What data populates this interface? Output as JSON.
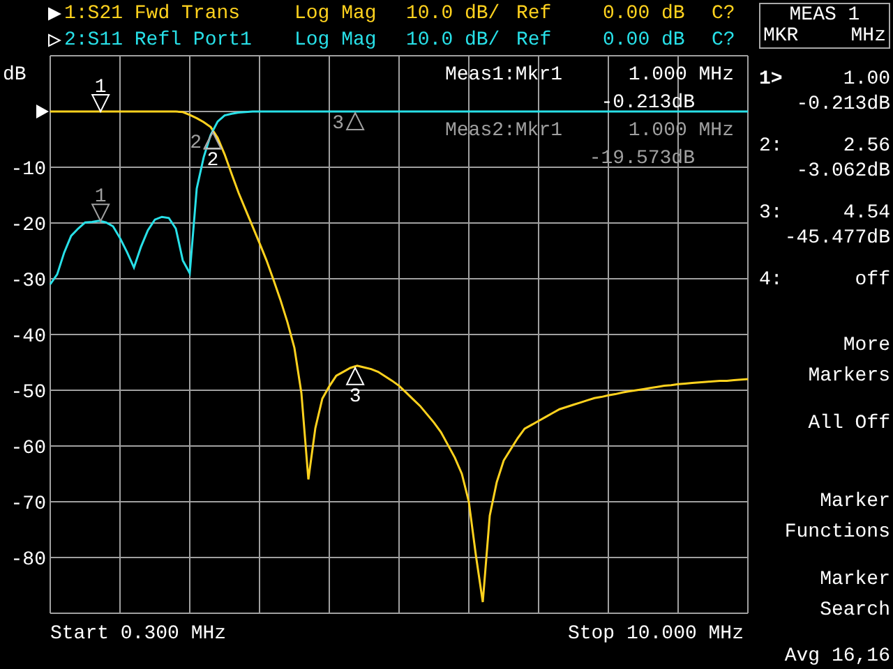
{
  "traces": [
    {
      "format": "Log Mag",
      "scale": "10.0 dB/",
      "ref_label": "Ref",
      "ref_value": "0.00 dB",
      "cal_status": "C?",
      "active": true,
      "marker_labels": [
        "1",
        "2",
        "3"
      ]
    },
    {
      "format": "Log Mag",
      "scale": "10.0 dB/",
      "ref_label": "Ref",
      "ref_value": "0.00 dB",
      "cal_status": "C?",
      "active": false,
      "marker_labels": [
        "1",
        "2",
        "3"
      ]
    }
  ],
  "readouts": [
    {
      "name": "Meas1:Mkr1",
      "frequency": "1.000 MHz",
      "value": "-0.213dB",
      "active": true
    },
    {
      "name": "Meas2:Mkr1",
      "frequency": "1.000 MHz",
      "value": "-19.573dB",
      "active": false
    }
  ],
  "chart_data": {
    "type": "line",
    "ylabel": "dB",
    "ylim": [
      -90,
      10
    ],
    "grid": true,
    "yticks": [
      {
        "value": -10,
        "label": "-10"
      },
      {
        "value": -20,
        "label": "-20"
      },
      {
        "value": -30,
        "label": "-30"
      },
      {
        "value": -40,
        "label": "-40"
      },
      {
        "value": -50,
        "label": "-50"
      },
      {
        "value": -60,
        "label": "-60"
      },
      {
        "value": -70,
        "label": "-70"
      },
      {
        "value": -80,
        "label": "-80"
      }
    ],
    "categories": [
      null,
      null,
      null,
      null,
      null,
      null,
      null,
      null,
      null,
      null,
      null,
      null,
      null,
      null,
      null,
      null,
      null,
      null,
      null,
      null,
      null,
      null,
      null,
      null,
      null,
      null,
      null,
      null,
      null,
      null,
      null,
      null,
      null,
      null,
      null,
      null,
      null,
      null,
      null,
      null,
      null,
      null,
      null,
      null,
      null,
      null,
      null,
      null,
      null,
      null,
      null,
      null,
      null,
      null,
      null,
      null,
      null,
      null,
      null,
      null,
      null,
      null,
      null,
      null,
      null,
      null,
      null,
      null,
      null,
      null,
      null,
      null,
      null,
      null,
      null,
      null,
      null,
      null,
      null,
      null,
      null,
      null,
      null,
      null,
      null,
      null,
      null,
      null,
      null,
      null,
      null,
      null,
      null,
      null,
      null,
      null,
      null,
      null,
      null,
      null,
      null
    ],
    "series": [
      {
        "name": "1:S21 Fwd Trans",
        "color": "#ffd21e",
        "values": [
          0,
          0,
          0,
          0,
          0,
          0,
          0,
          0,
          0,
          0,
          0,
          0,
          0,
          0,
          0,
          0,
          0,
          0,
          0,
          -0.1,
          -0.6,
          -1.2,
          -1.9,
          -2.8,
          -4.7,
          -7.7,
          -11.2,
          -14.6,
          -17.6,
          -20.6,
          -23.6,
          -26.7,
          -30.2,
          -33.8,
          -37.8,
          -42.4,
          -50.5,
          -66,
          -56.8,
          -51.5,
          -49.3,
          -47.4,
          -46.7,
          -46,
          -45.6,
          -45.9,
          -46.2,
          -46.7,
          -47.5,
          -48.3,
          -49.2,
          -50.4,
          -51.6,
          -52.8,
          -54.3,
          -55.8,
          -57.5,
          -59.8,
          -62.1,
          -65,
          -70,
          -79.5,
          -88,
          -72.5,
          -66.5,
          -62.6,
          -60.6,
          -58.6,
          -56.9,
          -56.2,
          -55.5,
          -54.8,
          -54.1,
          -53.4,
          -53,
          -52.6,
          -52.2,
          -51.8,
          -51.4,
          -51.2,
          -50.9,
          -50.7,
          -50.4,
          -50.2,
          -50,
          -49.8,
          -49.6,
          -49.4,
          -49.2,
          -49.1,
          -48.9,
          -48.8,
          -48.7,
          -48.6,
          -48.5,
          -48.4,
          -48.3,
          -48.3,
          -48.2,
          -48.1,
          -48
        ]
      },
      {
        "name": "2:S11 Refl Port1",
        "color": "#28e0e8",
        "values": [
          -31,
          -29.2,
          -25.3,
          -22.3,
          -21,
          -19.9,
          -19.8,
          -19.6,
          -19.9,
          -20.6,
          -22.7,
          -25.2,
          -28,
          -24.3,
          -21.3,
          -19.4,
          -18.9,
          -19.1,
          -21,
          -26.7,
          -29,
          -13.8,
          -8.2,
          -4.2,
          -1.8,
          -0.7,
          -0.4,
          -0.2,
          -0.1,
          0,
          0,
          0,
          0,
          0,
          0,
          0,
          0,
          0,
          0,
          0,
          0,
          0,
          0,
          0,
          0,
          0,
          0,
          0,
          0,
          0,
          0,
          0,
          0,
          0,
          0,
          0,
          0,
          0,
          0,
          0,
          0,
          0,
          0,
          0,
          0,
          0,
          0,
          0,
          0,
          0,
          0,
          0,
          0,
          0,
          0,
          0,
          0,
          0,
          0,
          0,
          0,
          0,
          0,
          0,
          0,
          0,
          0,
          0,
          0,
          0,
          0,
          0,
          0,
          0,
          0,
          0,
          0,
          0,
          0,
          0,
          0
        ]
      }
    ]
  },
  "start": "Start 0.300 MHz",
  "stop": "Stop 10.000 MHz",
  "panel": {
    "title": "MEAS 1",
    "unit_left": "MKR",
    "unit_right": "MHz",
    "markers": [
      {
        "label": "1>",
        "frequency": "1.00",
        "value": "-0.213dB",
        "selected": true
      },
      {
        "label": "2:",
        "frequency": "2.56",
        "value": "-3.062dB",
        "selected": false
      },
      {
        "label": "3:",
        "frequency": "4.54",
        "value": "-45.477dB",
        "selected": false
      },
      {
        "label": "4:",
        "frequency": "off",
        "selected": false
      }
    ],
    "softkeys": [
      {
        "lines": [
          "More",
          "Markers"
        ]
      },
      {
        "lines": [
          "All Off"
        ]
      },
      {
        "lines": [
          "Marker",
          "Functions"
        ]
      },
      {
        "lines": [
          "Marker",
          "Search"
        ]
      }
    ],
    "status": "Avg 16,16"
  }
}
